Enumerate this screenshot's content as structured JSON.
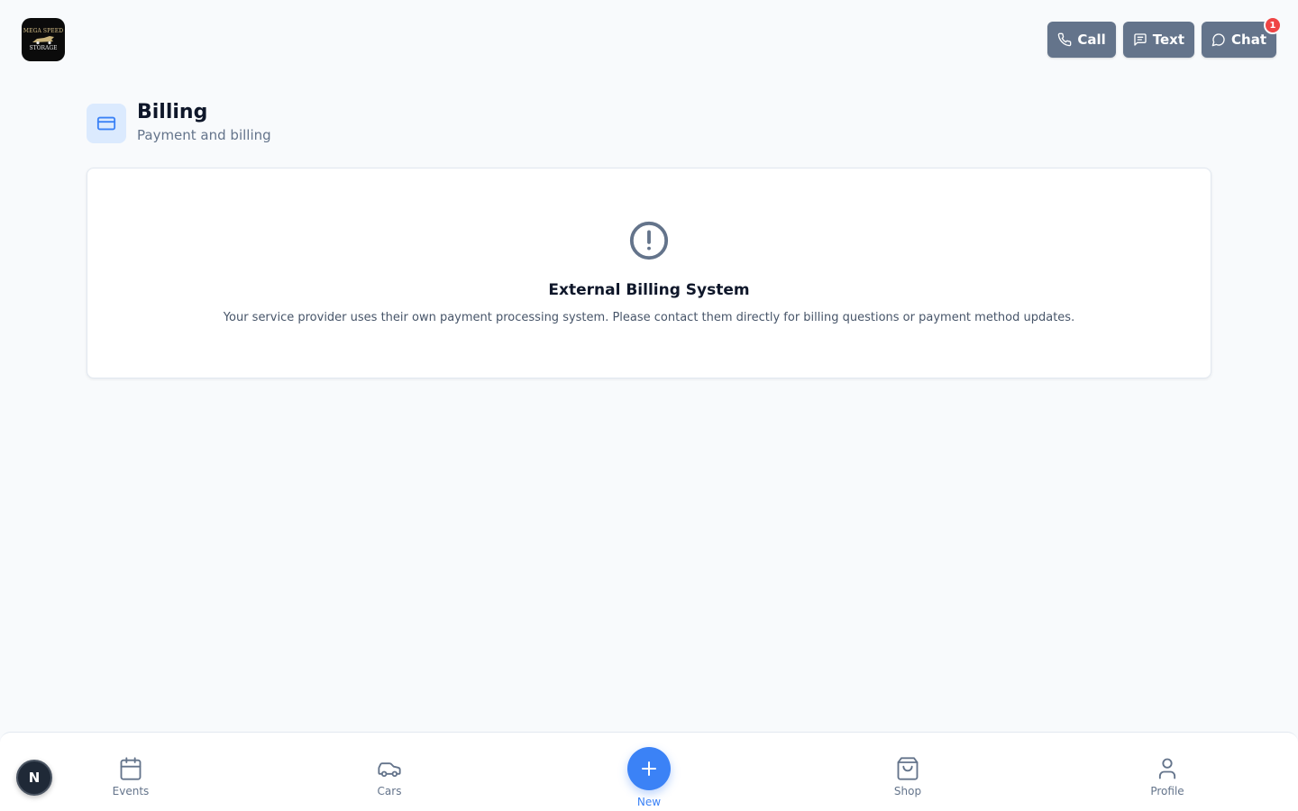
{
  "logo": {
    "line1": "MEGA SPEED",
    "line2": "STORAGE",
    "icon": "car-logo-icon"
  },
  "header": {
    "call_label": "Call",
    "text_label": "Text",
    "chat_label": "Chat",
    "chat_badge": "1",
    "icons": [
      "phone-icon",
      "message-square-icon",
      "chat-bubble-icon"
    ]
  },
  "page": {
    "title": "Billing",
    "subtitle": "Payment and billing",
    "icon": "credit-card-icon"
  },
  "card": {
    "icon": "alert-circle-icon",
    "title": "External Billing System",
    "text": "Your service provider uses their own payment processing system. Please contact them directly for billing questions or payment method updates."
  },
  "nav": {
    "avatar": "N",
    "events_label": "Events",
    "cars_label": "Cars",
    "new_label": "New",
    "shop_label": "Shop",
    "profile_label": "Profile",
    "icons": [
      "calendar-icon",
      "car-icon",
      "plus-icon",
      "shopping-bag-icon",
      "user-icon"
    ]
  },
  "colors": {
    "accent": "#3b82f6",
    "header_button": "#64748b",
    "badge": "#ef4444",
    "background": "#f8fafc"
  }
}
